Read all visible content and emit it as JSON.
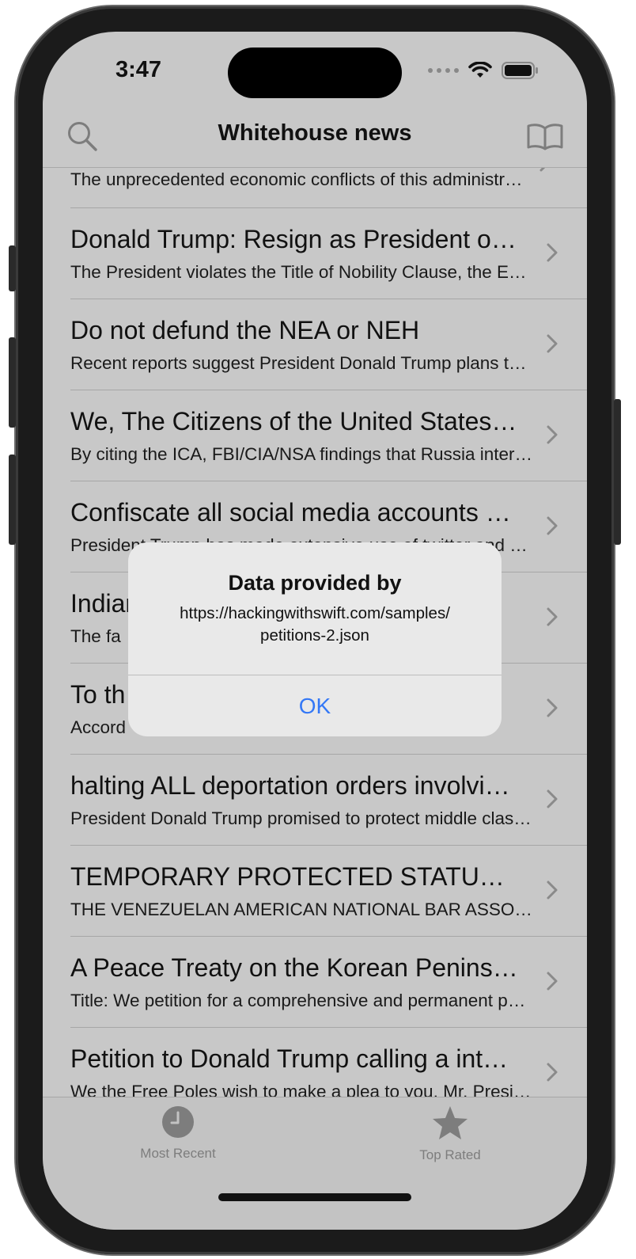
{
  "status": {
    "time": "3:47"
  },
  "nav": {
    "title": "Whitehouse news"
  },
  "list": {
    "partial_subtitle": "The unprecedented economic conflicts of this administration have created",
    "items": [
      {
        "title": "Donald Trump:  Resign as President of the United States",
        "subtitle": "The President violates the Title of Nobility Clause, the Emoluments Clause"
      },
      {
        "title": "Do not defund the NEA or NEH",
        "subtitle": "Recent reports suggest President Donald Trump plans to eliminate funding"
      },
      {
        "title": "We, The Citizens of the United States of America",
        "subtitle": "By citing the ICA, FBI/CIA/NSA findings that Russia interfered in the election"
      },
      {
        "title": "Confiscate all social media accounts of the President",
        "subtitle": "President Trump has made extensive use of twitter and other social media"
      },
      {
        "title": "Indian",
        "subtitle": "The fa"
      },
      {
        "title": "To th",
        "subtitle": "Accord"
      },
      {
        "title": "halting ALL deportation orders involving families",
        "subtitle": "President Donald Trump promised to protect middle class families"
      },
      {
        "title": "TEMPORARY PROTECTED STATUS FOR VENEZUELANS",
        "subtitle": "THE VENEZUELAN AMERICAN NATIONAL BAR ASSOCIATION"
      },
      {
        "title": "A Peace Treaty on the Korean Peninsula",
        "subtitle": "Title: We petition for a comprehensive and permanent peace treaty"
      },
      {
        "title": "Petition to Donald Trump calling a international",
        "subtitle": "We the Free Poles wish to make a plea to you, Mr. President"
      }
    ]
  },
  "tabbar": {
    "tabs": [
      {
        "label": "Most Recent",
        "icon": "clock-icon"
      },
      {
        "label": "Top Rated",
        "icon": "star-icon"
      }
    ]
  },
  "alert": {
    "title": "Data provided by",
    "message_line1": "https://hackingwithswift.com/samples/",
    "message_line2": "petitions-2.json",
    "ok_label": "OK"
  },
  "colors": {
    "accent": "#3478f6",
    "dimmed_background": "#c8c8c8"
  }
}
